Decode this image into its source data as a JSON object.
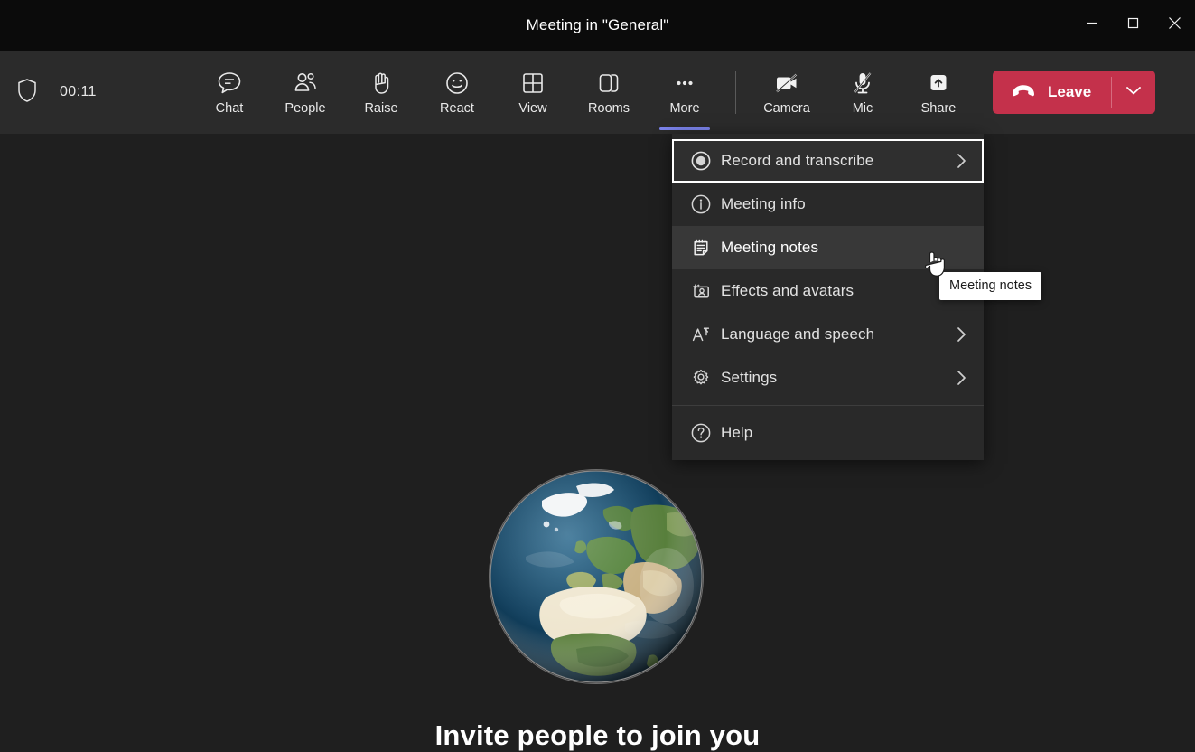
{
  "window": {
    "title": "Meeting in \"General\"",
    "controls": [
      {
        "name": "minimize",
        "glyph": "minimize-icon"
      },
      {
        "name": "maximize",
        "glyph": "maximize-icon"
      },
      {
        "name": "close",
        "glyph": "close-icon"
      }
    ]
  },
  "toolbar": {
    "shield_icon": "shield-icon",
    "timer": "00:11",
    "items": [
      {
        "label": "Chat",
        "icon": "chat-icon",
        "active": false
      },
      {
        "label": "People",
        "icon": "people-icon",
        "active": false
      },
      {
        "label": "Raise",
        "icon": "raise-hand-icon",
        "active": false
      },
      {
        "label": "React",
        "icon": "react-smiley-icon",
        "active": false
      },
      {
        "label": "View",
        "icon": "view-grid-icon",
        "active": false
      },
      {
        "label": "Rooms",
        "icon": "breakout-rooms-icon",
        "active": false
      },
      {
        "label": "More",
        "icon": "more-ellipsis-icon",
        "active": true
      }
    ],
    "media": [
      {
        "label": "Camera",
        "icon": "camera-off-icon",
        "muted": true
      },
      {
        "label": "Mic",
        "icon": "mic-off-icon",
        "muted": true
      },
      {
        "label": "Share",
        "icon": "share-screen-icon",
        "muted": false
      }
    ],
    "leave": {
      "label": "Leave",
      "icon": "hangup-phone-icon",
      "caret": "chevron-down-icon",
      "color": "#c4314b"
    },
    "active_accent": "#7b83eb"
  },
  "menu": {
    "items": [
      {
        "label": "Record and transcribe",
        "icon": "record-circle-icon",
        "submenu": true,
        "state": "focused"
      },
      {
        "label": "Meeting info",
        "icon": "info-circle-icon",
        "submenu": false,
        "state": "normal"
      },
      {
        "label": "Meeting notes",
        "icon": "notes-page-icon",
        "submenu": false,
        "state": "hovered"
      },
      {
        "label": "Effects and avatars",
        "icon": "effects-avatar-icon",
        "submenu": false,
        "state": "normal"
      },
      {
        "label": "Language and speech",
        "icon": "language-a-icon",
        "submenu": true,
        "state": "normal"
      },
      {
        "label": "Settings",
        "icon": "gear-icon",
        "submenu": true,
        "state": "normal"
      }
    ],
    "footer_items": [
      {
        "label": "Help",
        "icon": "help-circle-icon",
        "submenu": false,
        "state": "normal"
      }
    ]
  },
  "tooltip": {
    "text": "Meeting notes"
  },
  "stage": {
    "globe_alt": "earth-globe-europe-africa",
    "invite_text": "Invite people to join you"
  }
}
